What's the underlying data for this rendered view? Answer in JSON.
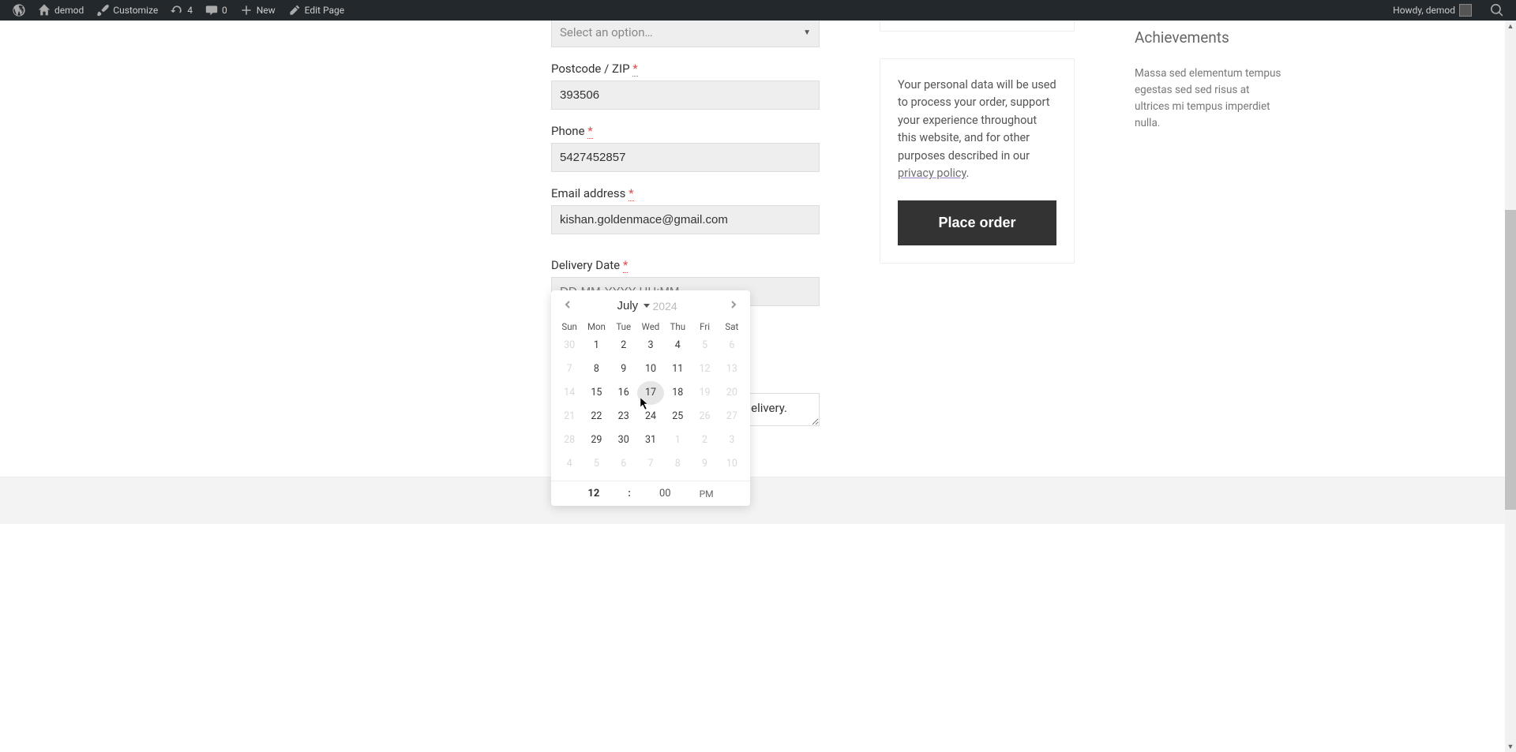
{
  "adminbar": {
    "site_name": "demod",
    "customize": "Customize",
    "updates_count": "4",
    "comments_count": "0",
    "new_label": "New",
    "edit_label": "Edit Page",
    "howdy": "Howdy, demod"
  },
  "form": {
    "state_placeholder": "Select an option…",
    "postcode_label": "Postcode / ZIP",
    "postcode_value": "393506",
    "phone_label": "Phone",
    "phone_value": "5427452857",
    "email_label": "Email address",
    "email_value": "kishan.goldenmace@gmail.com",
    "delivery_label": "Delivery Date",
    "delivery_placeholder": "DD-MM-YYYY HH:MM",
    "notes_visible_text": "delivery."
  },
  "calendar": {
    "month": "July",
    "year": "2024",
    "weekdays": [
      "Sun",
      "Mon",
      "Tue",
      "Wed",
      "Thu",
      "Fri",
      "Sat"
    ],
    "rows": [
      [
        {
          "d": "30",
          "off": true
        },
        {
          "d": "1"
        },
        {
          "d": "2"
        },
        {
          "d": "3"
        },
        {
          "d": "4"
        },
        {
          "d": "5",
          "off": true
        },
        {
          "d": "6",
          "off": true
        }
      ],
      [
        {
          "d": "7",
          "off": true
        },
        {
          "d": "8"
        },
        {
          "d": "9"
        },
        {
          "d": "10"
        },
        {
          "d": "11"
        },
        {
          "d": "12",
          "off": true
        },
        {
          "d": "13",
          "off": true
        }
      ],
      [
        {
          "d": "14",
          "off": true
        },
        {
          "d": "15"
        },
        {
          "d": "16"
        },
        {
          "d": "17",
          "hover": true
        },
        {
          "d": "18"
        },
        {
          "d": "19",
          "off": true
        },
        {
          "d": "20",
          "off": true
        }
      ],
      [
        {
          "d": "21",
          "off": true
        },
        {
          "d": "22"
        },
        {
          "d": "23"
        },
        {
          "d": "24"
        },
        {
          "d": "25"
        },
        {
          "d": "26",
          "off": true
        },
        {
          "d": "27",
          "off": true
        }
      ],
      [
        {
          "d": "28",
          "off": true
        },
        {
          "d": "29"
        },
        {
          "d": "30"
        },
        {
          "d": "31"
        },
        {
          "d": "1",
          "off": true
        },
        {
          "d": "2",
          "off": true
        },
        {
          "d": "3",
          "off": true
        }
      ],
      [
        {
          "d": "4",
          "off": true
        },
        {
          "d": "5",
          "off": true
        },
        {
          "d": "6",
          "off": true
        },
        {
          "d": "7",
          "off": true
        },
        {
          "d": "8",
          "off": true
        },
        {
          "d": "9",
          "off": true
        },
        {
          "d": "10",
          "off": true
        }
      ]
    ],
    "time_hour": "12",
    "time_colon": ":",
    "time_minute": "00",
    "time_ampm": "PM"
  },
  "privacy": {
    "text_before": "Your personal data will be used to process your order, support your experience throughout this website, and for other purposes described in our ",
    "link_text": "privacy policy",
    "text_after": ".",
    "button": "Place order"
  },
  "sidebar": {
    "title": "Achievements",
    "text": "Massa sed elementum tempus egestas sed sed risus at ultrices mi tempus imperdiet nulla."
  }
}
